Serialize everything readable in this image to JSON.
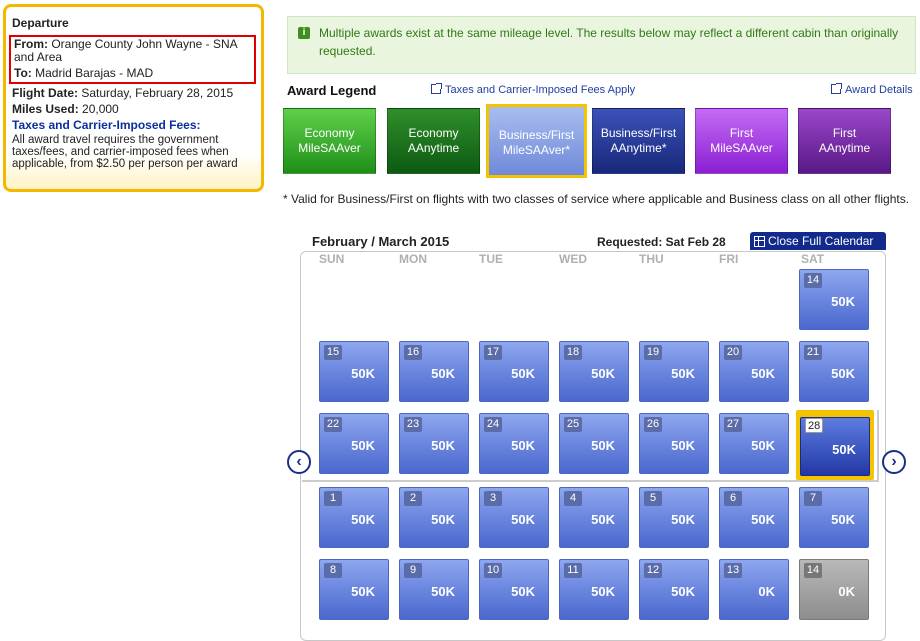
{
  "departure": {
    "title": "Departure",
    "from_label": "From:",
    "from_value": "Orange County John Wayne - SNA and Area",
    "to_label": "To:",
    "to_value": "Madrid Barajas - MAD",
    "date_label": "Flight Date:",
    "date_value": "Saturday, February 28, 2015",
    "miles_label": "Miles Used:",
    "miles_value": "20,000",
    "taxes_heading": "Taxes and Carrier-Imposed Fees:",
    "taxes_text": "All award travel requires the government taxes/fees, and carrier-imposed fees when applicable, from $2.50 per person per award"
  },
  "notice": {
    "icon": "i",
    "text": "Multiple awards exist at the same mileage level. The results below may reflect a different cabin than originally requested."
  },
  "legend": {
    "title": "Award Legend",
    "taxes_link": "Taxes and Carrier-Imposed Fees Apply",
    "details_link": "Award Details",
    "awards": [
      {
        "line1": "Economy",
        "line2": "MileSAAver"
      },
      {
        "line1": "Economy",
        "line2": "AAnytime"
      },
      {
        "line1": "Business/First",
        "line2": "MileSAAver*"
      },
      {
        "line1": "Business/First",
        "line2": "AAnytime*"
      },
      {
        "line1": "First",
        "line2": "MileSAAver"
      },
      {
        "line1": "First",
        "line2": "AAnytime"
      }
    ],
    "note": "* Valid for Business/First on flights with two classes of service where applicable and Business class on all other flights."
  },
  "calendar": {
    "month_label": "February / March 2015",
    "requested": "Requested: Sat Feb 28",
    "close_label": "Close Full Calendar",
    "days": [
      "SUN",
      "MON",
      "TUE",
      "WED",
      "THU",
      "FRI",
      "SAT"
    ],
    "prev_icon": "‹",
    "next_icon": "›",
    "rows": [
      [
        null,
        null,
        null,
        null,
        null,
        null,
        {
          "d": "14",
          "m": "50K"
        }
      ],
      [
        {
          "d": "15",
          "m": "50K"
        },
        {
          "d": "16",
          "m": "50K"
        },
        {
          "d": "17",
          "m": "50K"
        },
        {
          "d": "18",
          "m": "50K"
        },
        {
          "d": "19",
          "m": "50K"
        },
        {
          "d": "20",
          "m": "50K"
        },
        {
          "d": "21",
          "m": "50K"
        }
      ],
      [
        {
          "d": "22",
          "m": "50K"
        },
        {
          "d": "23",
          "m": "50K"
        },
        {
          "d": "24",
          "m": "50K"
        },
        {
          "d": "25",
          "m": "50K"
        },
        {
          "d": "26",
          "m": "50K"
        },
        {
          "d": "27",
          "m": "50K"
        },
        {
          "d": "28",
          "m": "50K",
          "selected": true
        }
      ],
      [
        {
          "d": "1",
          "m": "50K"
        },
        {
          "d": "2",
          "m": "50K"
        },
        {
          "d": "3",
          "m": "50K"
        },
        {
          "d": "4",
          "m": "50K"
        },
        {
          "d": "5",
          "m": "50K"
        },
        {
          "d": "6",
          "m": "50K"
        },
        {
          "d": "7",
          "m": "50K"
        }
      ],
      [
        {
          "d": "8",
          "m": "50K"
        },
        {
          "d": "9",
          "m": "50K"
        },
        {
          "d": "10",
          "m": "50K"
        },
        {
          "d": "11",
          "m": "50K"
        },
        {
          "d": "12",
          "m": "50K"
        },
        {
          "d": "13",
          "m": "0K"
        },
        {
          "d": "14",
          "m": "0K",
          "gray": true
        }
      ]
    ]
  }
}
